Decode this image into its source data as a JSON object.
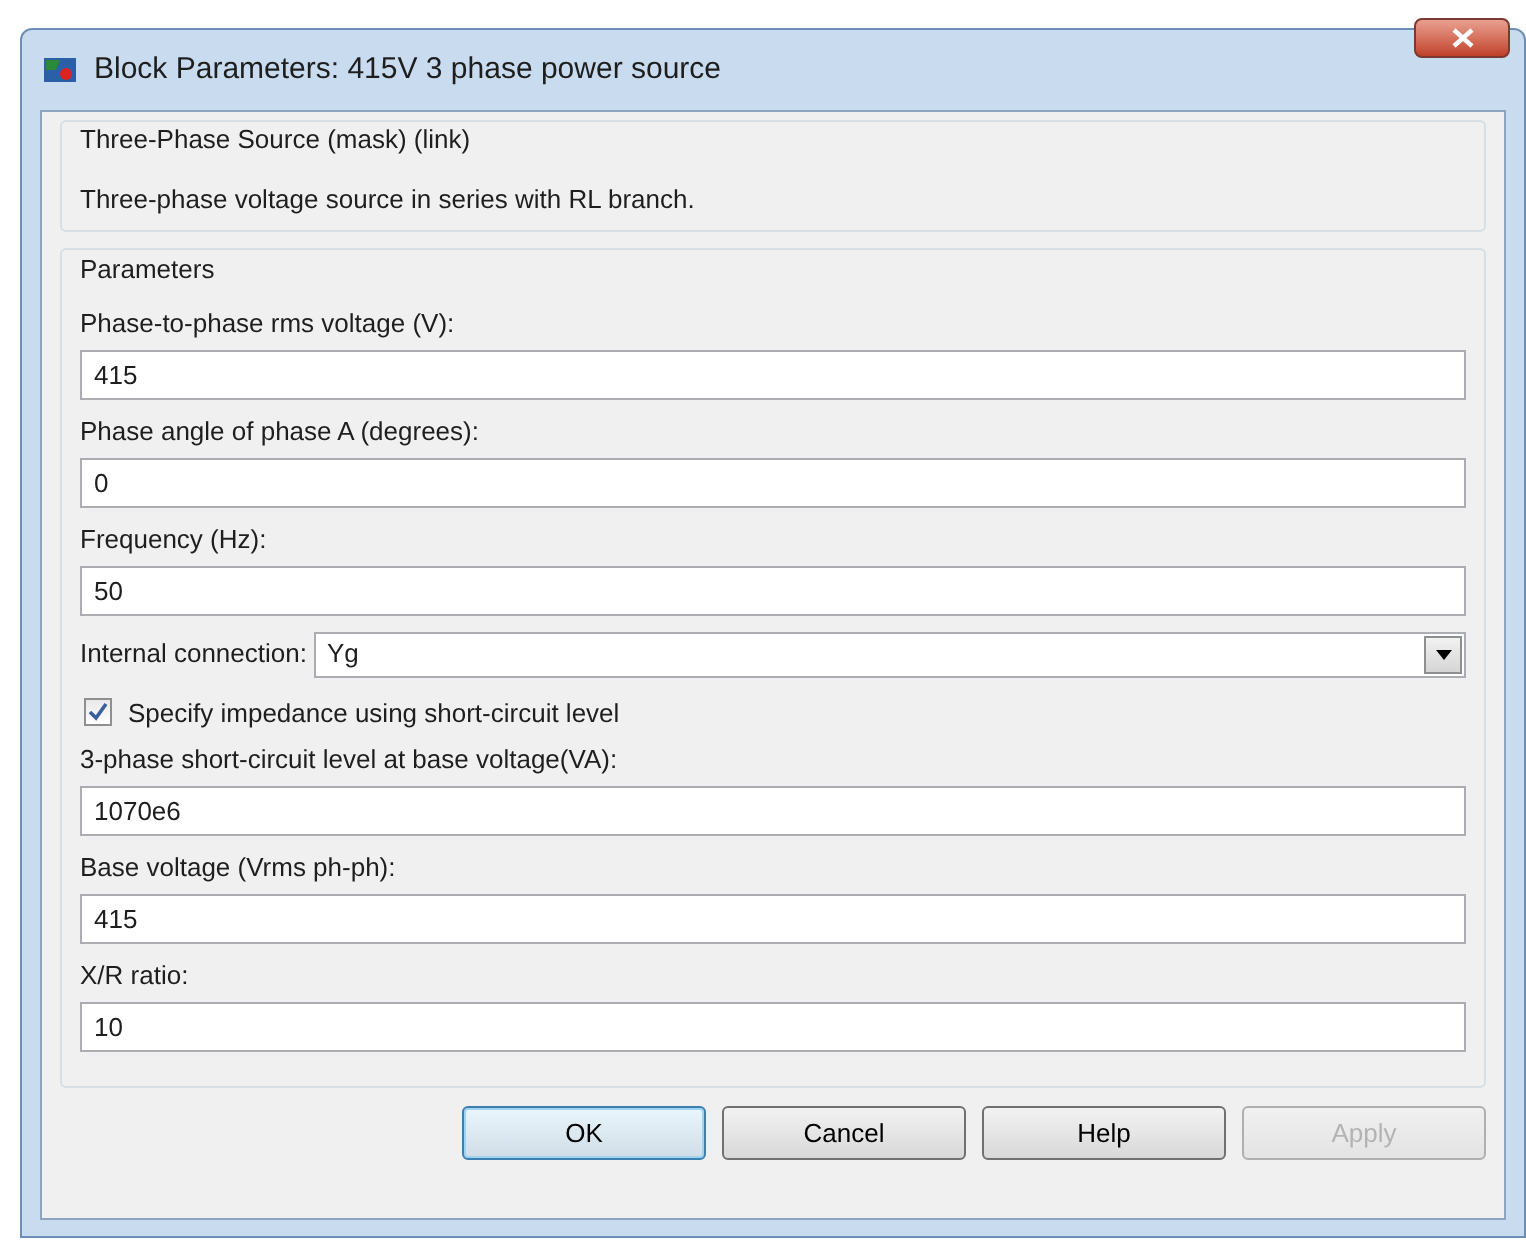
{
  "window": {
    "title": "Block Parameters: 415V 3 phase power source"
  },
  "description_group": {
    "title": "Three-Phase Source (mask) (link)",
    "text": "Three-phase voltage source in series with RL branch."
  },
  "parameters": {
    "title": "Parameters",
    "fields": [
      {
        "kind": "text",
        "label": "Phase-to-phase rms voltage (V):",
        "value": "415"
      },
      {
        "kind": "text",
        "label": "Phase angle of phase A (degrees):",
        "value": "0"
      },
      {
        "kind": "text",
        "label": "Frequency (Hz):",
        "value": "50"
      },
      {
        "kind": "dropdown",
        "label": "Internal connection:",
        "value": "Yg"
      },
      {
        "kind": "checkbox",
        "label": "Specify impedance using short-circuit level",
        "checked": true
      },
      {
        "kind": "text",
        "label": "3-phase short-circuit level at base voltage(VA):",
        "value": "1070e6"
      },
      {
        "kind": "text",
        "label": "Base voltage (Vrms ph-ph):",
        "value": "415"
      },
      {
        "kind": "text",
        "label": "X/R ratio:",
        "value": "10"
      }
    ]
  },
  "buttons": [
    {
      "label": "OK",
      "default": true,
      "disabled": false
    },
    {
      "label": "Cancel",
      "default": false,
      "disabled": false
    },
    {
      "label": "Help",
      "default": false,
      "disabled": false
    },
    {
      "label": "Apply",
      "default": false,
      "disabled": true
    }
  ]
}
